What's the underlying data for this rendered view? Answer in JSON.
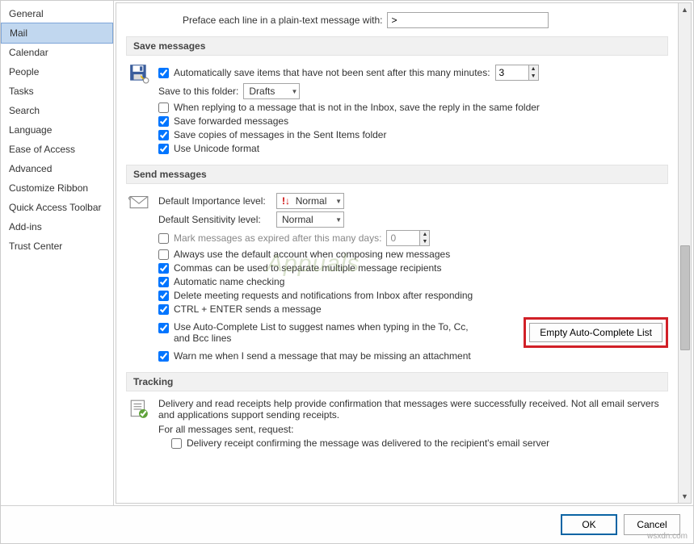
{
  "sidebar": {
    "items": [
      {
        "label": "General"
      },
      {
        "label": "Mail"
      },
      {
        "label": "Calendar"
      },
      {
        "label": "People"
      },
      {
        "label": "Tasks"
      },
      {
        "label": "Search"
      },
      {
        "label": "Language"
      },
      {
        "label": "Ease of Access"
      },
      {
        "label": "Advanced"
      },
      {
        "label": "Customize Ribbon"
      },
      {
        "label": "Quick Access Toolbar"
      },
      {
        "label": "Add-ins"
      },
      {
        "label": "Trust Center"
      }
    ],
    "selected_index": 1
  },
  "preface": {
    "label": "Preface each line in a plain-text message with:",
    "value": ">"
  },
  "sections": {
    "save": {
      "title": "Save messages",
      "auto_save": {
        "label": "Automatically save items that have not been sent after this many minutes:",
        "checked": true,
        "value": "3"
      },
      "folder": {
        "label": "Save to this folder:",
        "value": "Drafts"
      },
      "reply_same_folder": {
        "label": "When replying to a message that is not in the Inbox, save the reply in the same folder",
        "checked": false
      },
      "save_forwarded": {
        "label": "Save forwarded messages",
        "checked": true
      },
      "save_sent_copies": {
        "label": "Save copies of messages in the Sent Items folder",
        "checked": true
      },
      "unicode": {
        "label": "Use Unicode format",
        "checked": true
      }
    },
    "send": {
      "title": "Send messages",
      "importance": {
        "label": "Default Importance level:",
        "value": "Normal"
      },
      "sensitivity": {
        "label": "Default Sensitivity level:",
        "value": "Normal"
      },
      "mark_expired": {
        "label": "Mark messages as expired after this many days:",
        "checked": false,
        "value": "0"
      },
      "default_account": {
        "label": "Always use the default account when composing new messages",
        "checked": false
      },
      "commas": {
        "label": "Commas can be used to separate multiple message recipients",
        "checked": true
      },
      "auto_name": {
        "label": "Automatic name checking",
        "checked": true
      },
      "delete_meeting": {
        "label": "Delete meeting requests and notifications from Inbox after responding",
        "checked": true
      },
      "ctrl_enter": {
        "label": "CTRL + ENTER sends a message",
        "checked": true
      },
      "autocomplete": {
        "label": "Use Auto-Complete List to suggest names when typing in the To, Cc, and Bcc lines",
        "checked": true
      },
      "warn_attach": {
        "label": "Warn me when I send a message that may be missing an attachment",
        "checked": true
      },
      "empty_btn": "Empty Auto-Complete List"
    },
    "tracking": {
      "title": "Tracking",
      "desc": "Delivery and read receipts help provide confirmation that messages were successfully received. Not all email servers and applications support sending receipts.",
      "request_label": "For all messages sent, request:",
      "delivery_receipt": {
        "label": "Delivery receipt confirming the message was delivered to the recipient's email server",
        "checked": false
      }
    }
  },
  "footer": {
    "ok": "OK",
    "cancel": "Cancel"
  },
  "watermark": "Appuals"
}
